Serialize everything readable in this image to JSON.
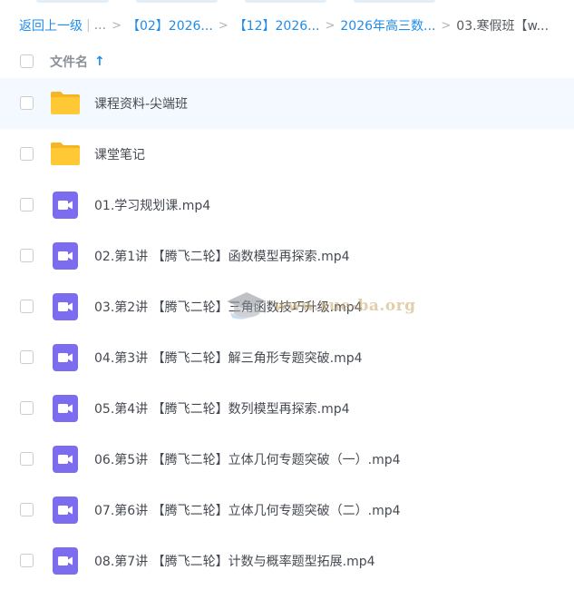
{
  "breadcrumb": {
    "back": "返回上一级",
    "pipe": "|",
    "dots": "...",
    "sep": ">",
    "crumbs": [
      "【02】2026...",
      "【12】2026...",
      "2026年高三数..."
    ],
    "current": "03.寒假班【w..."
  },
  "header": {
    "name_label": "文件名",
    "sort_arrow": "↑"
  },
  "files": [
    {
      "name": "课程资料-尖端班",
      "type": "folder"
    },
    {
      "name": "课堂笔记",
      "type": "folder"
    },
    {
      "name": "01.学习规划课.mp4",
      "type": "video"
    },
    {
      "name": "02.第1讲 【腾飞二轮】函数模型再探索.mp4",
      "type": "video"
    },
    {
      "name": "03.第2讲 【腾飞二轮】三角函数技巧升级.mp4",
      "type": "video"
    },
    {
      "name": "04.第3讲 【腾飞二轮】解三角形专题突破.mp4",
      "type": "video"
    },
    {
      "name": "05.第4讲 【腾飞二轮】数列模型再探索.mp4",
      "type": "video"
    },
    {
      "name": "06.第5讲 【腾飞二轮】立体几何专题突破（一）.mp4",
      "type": "video"
    },
    {
      "name": "07.第6讲 【腾飞二轮】立体几何专题突破（二）.mp4",
      "type": "video"
    },
    {
      "name": "08.第7讲 【腾飞二轮】计数与概率题型拓展.mp4",
      "type": "video"
    }
  ],
  "watermark": {
    "text": "www.xue-ba.org"
  },
  "colors": {
    "link": "#1f8ceb",
    "folder": "#ffc936",
    "video": "#7b6cf0",
    "hover_row": "#f3f9fe"
  }
}
